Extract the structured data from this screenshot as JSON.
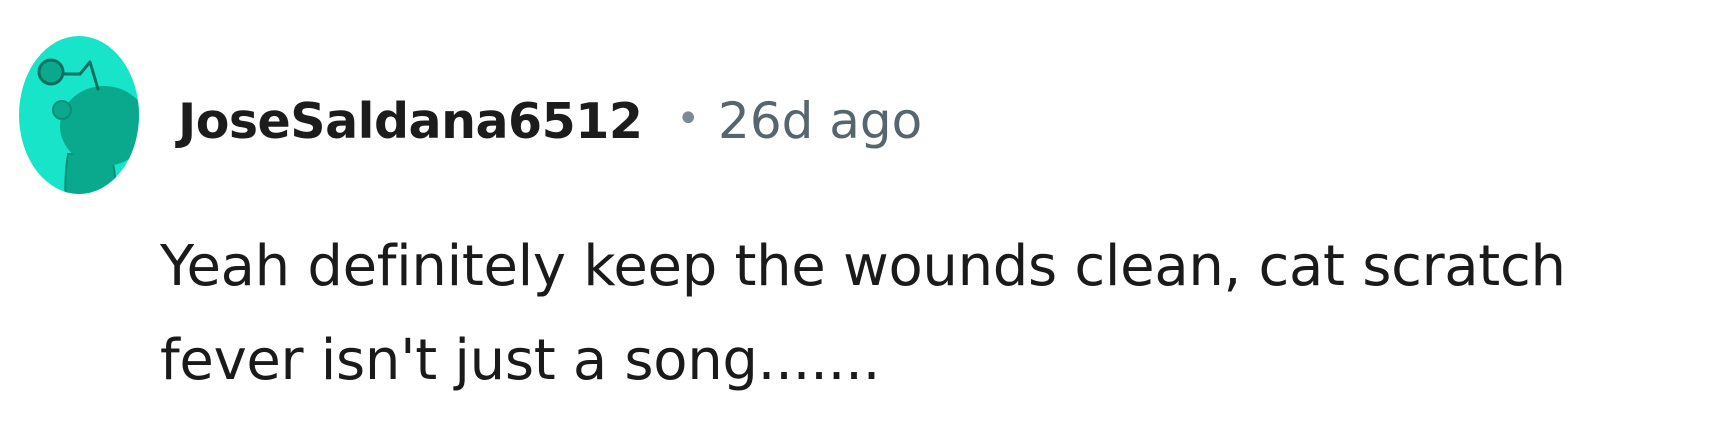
{
  "comment": {
    "avatar_icon": "reddit-snoo-avatar-icon",
    "avatar_color": "#18e4c9",
    "username": "JoseSaldana6512",
    "separator": "•",
    "timestamp": "26d ago",
    "body_lines": [
      "Yeah definitely keep the wounds clean, cat scratch",
      "fever isn't just a song......."
    ]
  },
  "colors": {
    "username": "#1c1c1c",
    "timestamp": "#56656e",
    "body": "#1a1a1a",
    "avatar_background": "#18e4c9",
    "avatar_figure": "#0aa88d"
  }
}
